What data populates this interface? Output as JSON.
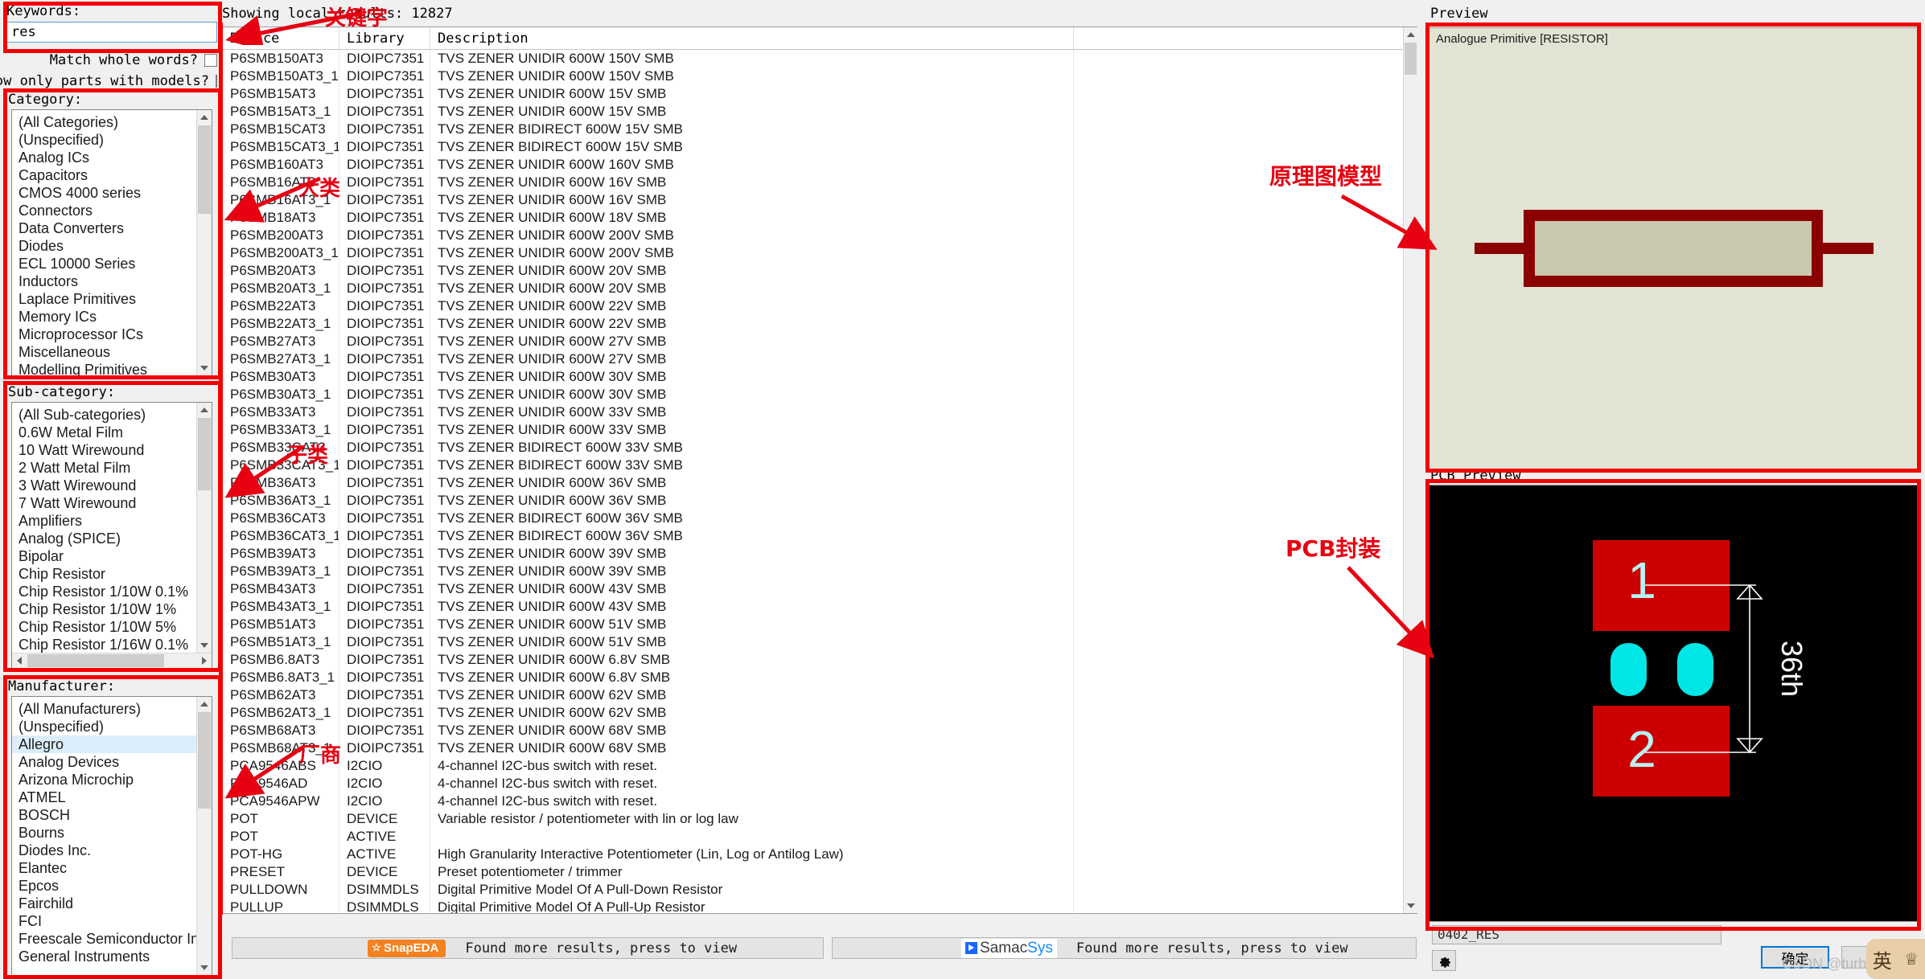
{
  "search": {
    "keywords_label": "Keywords:",
    "keywords_value": "res",
    "match_whole_words_label": "Match whole words?",
    "show_only_models_label": "Show only parts with models?"
  },
  "category": {
    "label": "Category:",
    "items": [
      "(All Categories)",
      "(Unspecified)",
      "Analog ICs",
      "Capacitors",
      "CMOS 4000 series",
      "Connectors",
      "Data Converters",
      "Diodes",
      "ECL 10000 Series",
      "Inductors",
      "Laplace Primitives",
      "Memory ICs",
      "Microprocessor ICs",
      "Miscellaneous",
      "Modelling Primitives"
    ]
  },
  "subcategory": {
    "label": "Sub-category:",
    "items": [
      "(All Sub-categories)",
      "0.6W Metal Film",
      "10 Watt Wirewound",
      "2 Watt Metal Film",
      "3 Watt Wirewound",
      "7 Watt Wirewound",
      "Amplifiers",
      "Analog (SPICE)",
      "Bipolar",
      "Chip Resistor",
      "Chip Resistor 1/10W 0.1%",
      "Chip Resistor 1/10W 1%",
      "Chip Resistor 1/10W 5%",
      "Chip Resistor 1/16W 0.1%"
    ]
  },
  "manufacturer": {
    "label": "Manufacturer:",
    "selected": "Allegro",
    "items": [
      "(All Manufacturers)",
      "(Unspecified)",
      "Allegro",
      "Analog Devices",
      "Arizona Microchip",
      "ATMEL",
      "BOSCH",
      "Bourns",
      "Diodes Inc.",
      "Elantec",
      "Epcos",
      "Fairchild",
      "FCI",
      "Freescale Semiconductor Inc",
      "General Instruments"
    ]
  },
  "results": {
    "status": "Showing local results: 12827",
    "columns": [
      "Device",
      "Library",
      "Description"
    ],
    "rows": [
      [
        "P6SMB150AT3",
        "DIOIPC7351",
        "TVS ZENER UNIDIR 600W 150V SMB"
      ],
      [
        "P6SMB150AT3_1",
        "DIOIPC7351",
        "TVS ZENER UNIDIR 600W 150V SMB"
      ],
      [
        "P6SMB15AT3",
        "DIOIPC7351",
        "TVS ZENER UNIDIR 600W 15V SMB"
      ],
      [
        "P6SMB15AT3_1",
        "DIOIPC7351",
        "TVS ZENER UNIDIR 600W 15V SMB"
      ],
      [
        "P6SMB15CAT3",
        "DIOIPC7351",
        "TVS ZENER BIDIRECT 600W 15V SMB"
      ],
      [
        "P6SMB15CAT3_1",
        "DIOIPC7351",
        "TVS ZENER BIDIRECT 600W 15V SMB"
      ],
      [
        "P6SMB160AT3",
        "DIOIPC7351",
        "TVS ZENER UNIDIR 600W 160V SMB"
      ],
      [
        "P6SMB16AT3",
        "DIOIPC7351",
        "TVS ZENER UNIDIR 600W 16V SMB"
      ],
      [
        "P6SMB16AT3_1",
        "DIOIPC7351",
        "TVS ZENER UNIDIR 600W 16V SMB"
      ],
      [
        "P6SMB18AT3",
        "DIOIPC7351",
        "TVS ZENER UNIDIR 600W 18V SMB"
      ],
      [
        "P6SMB200AT3",
        "DIOIPC7351",
        "TVS ZENER UNIDIR 600W 200V SMB"
      ],
      [
        "P6SMB200AT3_1",
        "DIOIPC7351",
        "TVS ZENER UNIDIR 600W 200V SMB"
      ],
      [
        "P6SMB20AT3",
        "DIOIPC7351",
        "TVS ZENER UNIDIR 600W 20V SMB"
      ],
      [
        "P6SMB20AT3_1",
        "DIOIPC7351",
        "TVS ZENER UNIDIR 600W 20V SMB"
      ],
      [
        "P6SMB22AT3",
        "DIOIPC7351",
        "TVS ZENER UNIDIR 600W 22V SMB"
      ],
      [
        "P6SMB22AT3_1",
        "DIOIPC7351",
        "TVS ZENER UNIDIR 600W 22V SMB"
      ],
      [
        "P6SMB27AT3",
        "DIOIPC7351",
        "TVS ZENER UNIDIR 600W 27V SMB"
      ],
      [
        "P6SMB27AT3_1",
        "DIOIPC7351",
        "TVS ZENER UNIDIR 600W 27V SMB"
      ],
      [
        "P6SMB30AT3",
        "DIOIPC7351",
        "TVS ZENER UNIDIR 600W 30V SMB"
      ],
      [
        "P6SMB30AT3_1",
        "DIOIPC7351",
        "TVS ZENER UNIDIR 600W 30V SMB"
      ],
      [
        "P6SMB33AT3",
        "DIOIPC7351",
        "TVS ZENER UNIDIR 600W 33V SMB"
      ],
      [
        "P6SMB33AT3_1",
        "DIOIPC7351",
        "TVS ZENER UNIDIR 600W 33V SMB"
      ],
      [
        "P6SMB33CAT3",
        "DIOIPC7351",
        "TVS ZENER BIDIRECT 600W 33V SMB"
      ],
      [
        "P6SMB33CAT3_1",
        "DIOIPC7351",
        "TVS ZENER BIDIRECT 600W 33V SMB"
      ],
      [
        "P6SMB36AT3",
        "DIOIPC7351",
        "TVS ZENER UNIDIR 600W 36V SMB"
      ],
      [
        "P6SMB36AT3_1",
        "DIOIPC7351",
        "TVS ZENER UNIDIR 600W 36V SMB"
      ],
      [
        "P6SMB36CAT3",
        "DIOIPC7351",
        "TVS ZENER BIDIRECT 600W 36V SMB"
      ],
      [
        "P6SMB36CAT3_1",
        "DIOIPC7351",
        "TVS ZENER BIDIRECT 600W 36V SMB"
      ],
      [
        "P6SMB39AT3",
        "DIOIPC7351",
        "TVS ZENER UNIDIR 600W 39V SMB"
      ],
      [
        "P6SMB39AT3_1",
        "DIOIPC7351",
        "TVS ZENER UNIDIR 600W 39V SMB"
      ],
      [
        "P6SMB43AT3",
        "DIOIPC7351",
        "TVS ZENER UNIDIR 600W 43V SMB"
      ],
      [
        "P6SMB43AT3_1",
        "DIOIPC7351",
        "TVS ZENER UNIDIR 600W 43V SMB"
      ],
      [
        "P6SMB51AT3",
        "DIOIPC7351",
        "TVS ZENER UNIDIR 600W 51V SMB"
      ],
      [
        "P6SMB51AT3_1",
        "DIOIPC7351",
        "TVS ZENER UNIDIR 600W 51V SMB"
      ],
      [
        "P6SMB6.8AT3",
        "DIOIPC7351",
        "TVS ZENER UNIDIR 600W 6.8V SMB"
      ],
      [
        "P6SMB6.8AT3_1",
        "DIOIPC7351",
        "TVS ZENER UNIDIR 600W 6.8V SMB"
      ],
      [
        "P6SMB62AT3",
        "DIOIPC7351",
        "TVS ZENER UNIDIR 600W 62V SMB"
      ],
      [
        "P6SMB62AT3_1",
        "DIOIPC7351",
        "TVS ZENER UNIDIR 600W 62V SMB"
      ],
      [
        "P6SMB68AT3",
        "DIOIPC7351",
        "TVS ZENER UNIDIR 600W 68V SMB"
      ],
      [
        "P6SMB68AT3_1",
        "DIOIPC7351",
        "TVS ZENER UNIDIR 600W 68V SMB"
      ],
      [
        "PCA9546ABS",
        "I2CIO",
        "4-channel I2C-bus switch with reset."
      ],
      [
        "PCA9546AD",
        "I2CIO",
        "4-channel I2C-bus switch with reset."
      ],
      [
        "PCA9546APW",
        "I2CIO",
        "4-channel I2C-bus switch with reset."
      ],
      [
        "POT",
        "DEVICE",
        "Variable resistor / potentiometer with lin or log law"
      ],
      [
        "POT",
        "ACTIVE",
        ""
      ],
      [
        "POT-HG",
        "ACTIVE",
        "High Granularity Interactive Potentiometer (Lin, Log or Antilog Law)"
      ],
      [
        "PRESET",
        "DEVICE",
        "Preset potentiometer / trimmer"
      ],
      [
        "PULLDOWN",
        "DSIMMDLS",
        "Digital Primitive Model Of A Pull-Down Resistor"
      ],
      [
        "PULLUP",
        "DSIMMDLS",
        "Digital Primitive Model Of A Pull-Up Resistor"
      ]
    ]
  },
  "preview": {
    "label": "Preview",
    "symbol_caption": "Analogue Primitive [RESISTOR]"
  },
  "pcb_preview": {
    "label": "PCB Preview",
    "pad1": "1",
    "pad2": "2",
    "dimension": "36th",
    "footprint_name": "0402_RES"
  },
  "footer": {
    "snapeda_logo": "SnapEDA",
    "snapeda_text": "Found more results, press to view",
    "samacsys_logo_a": "Samac",
    "samacsys_logo_b": "Sys",
    "samacsys_text": "Found more results, press to view",
    "settings_icon": "gear-icon",
    "ok_button": "确定"
  },
  "annotations": {
    "keywords": "关键字",
    "category": "大类",
    "subcategory": "子类",
    "manufacturer": "厂商",
    "schematic_model": "原理图模型",
    "pcb_package": "PCB封装"
  },
  "watermark": "CSDN @turbosqi",
  "colors": {
    "annotation_red": "#f50000",
    "selection_blue": "#dbeefd",
    "symbol_dark_red": "#8b0000",
    "preview_bg": "#e3e3d4",
    "pad_red": "#cc0000",
    "pad_cyan": "#00e5e5",
    "snapeda_orange": "#f58220",
    "focus_blue": "#0078d7"
  }
}
